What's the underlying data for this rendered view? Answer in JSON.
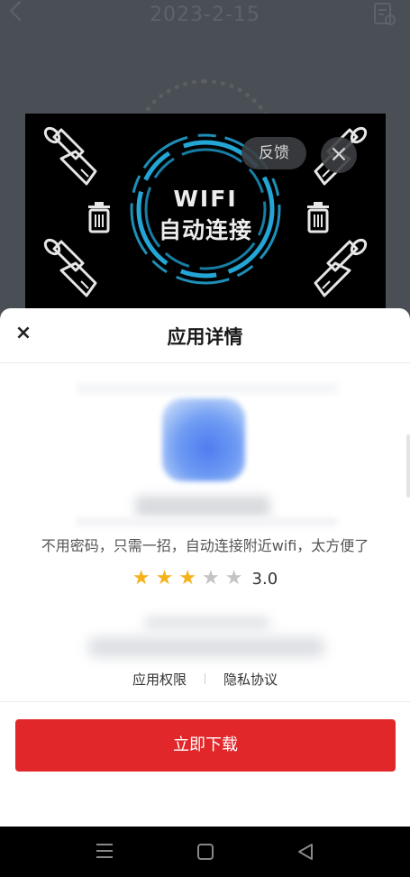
{
  "background": {
    "title": "2023-2-15"
  },
  "ad": {
    "headline_line1": "WIFI",
    "headline_line2": "自动连接",
    "feedback_label": "反馈",
    "close_icon": "close-icon",
    "icons": [
      "broom-icon",
      "trash-icon"
    ]
  },
  "sheet": {
    "close_glyph": "×",
    "title": "应用详情",
    "description": "不用密码，只需一招，自动连接附近wifi，太方便了",
    "rating": {
      "value": 3.0,
      "value_text": "3.0",
      "max": 5
    },
    "links": {
      "permissions": "应用权限",
      "privacy": "隐私协议"
    },
    "download_label": "立即下载"
  },
  "colors": {
    "accent": "#e2272a",
    "star_on": "#f5b21b",
    "star_off": "#c4c4c4"
  }
}
